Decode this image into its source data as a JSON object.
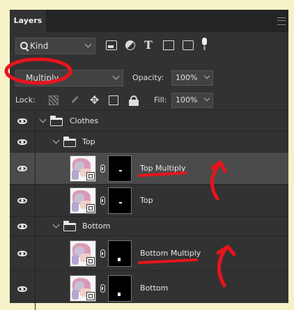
{
  "panel": {
    "tab": "Layers"
  },
  "filter": {
    "kind_label": "Kind"
  },
  "blend": {
    "mode": "Multiply",
    "opacity_label": "Opacity:",
    "opacity_value": "100%"
  },
  "lock": {
    "label": "Lock:",
    "fill_label": "Fill:",
    "fill_value": "100%"
  },
  "layers": [
    {
      "name": "Clothes",
      "type": "group",
      "visible": true
    },
    {
      "name": "Top",
      "type": "group",
      "visible": true
    },
    {
      "name": "Top Multiply",
      "type": "layer",
      "visible": true,
      "selected": true
    },
    {
      "name": "Top",
      "type": "layer",
      "visible": true
    },
    {
      "name": "Bottom",
      "type": "group",
      "visible": true
    },
    {
      "name": "Bottom Multiply",
      "type": "layer",
      "visible": true
    },
    {
      "name": "Bottom",
      "type": "layer",
      "visible": true
    }
  ],
  "colors": {
    "panel_bg": "#323232",
    "selected_row": "#4b4b4b",
    "annotation": "#e8141c",
    "backdrop": "#f6f2c8"
  },
  "icons": [
    "search-icon",
    "pixel-filter-icon",
    "adjustment-filter-icon",
    "type-filter-icon",
    "shape-filter-icon",
    "smart-object-filter-icon",
    "filter-toggle-icon",
    "lock-transparent-icon",
    "lock-brush-icon",
    "lock-move-icon",
    "lock-artboard-icon",
    "lock-all-icon",
    "eye-icon",
    "folder-icon",
    "link-icon",
    "panel-menu-icon"
  ]
}
